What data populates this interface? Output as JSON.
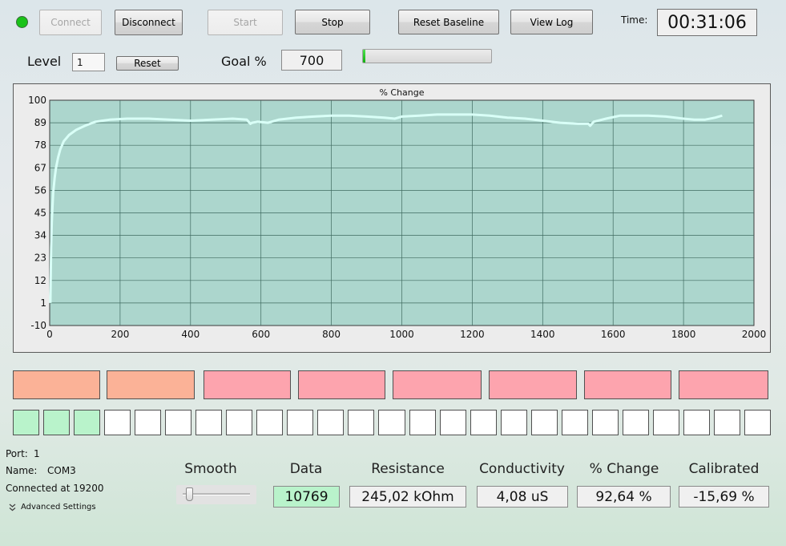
{
  "toolbar": {
    "connect_label": "Connect",
    "disconnect_label": "Disconnect",
    "start_label": "Start",
    "stop_label": "Stop",
    "reset_baseline_label": "Reset Baseline",
    "view_log_label": "View Log",
    "time_label": "Time:",
    "time_value": "00:31:06",
    "status_color": "#19c219"
  },
  "level": {
    "label": "Level",
    "value": "1",
    "reset_label": "Reset"
  },
  "goal": {
    "label": "Goal %",
    "value": "700",
    "progress_fraction": 0.02
  },
  "chart_data": {
    "type": "line",
    "title": "% Change",
    "xlabel": "",
    "ylabel": "",
    "xlim": [
      0,
      2000
    ],
    "ylim": [
      -10,
      100
    ],
    "x_ticks": [
      0,
      200,
      400,
      600,
      800,
      1000,
      1200,
      1400,
      1600,
      1800,
      2000
    ],
    "y_ticks": [
      -10,
      1,
      12,
      23,
      34,
      45,
      56,
      67,
      78,
      89,
      100
    ],
    "grid": true,
    "background_color": "#acd6cd",
    "line_color": "#d9fff7",
    "series": [
      {
        "x": [
          2,
          4,
          6,
          8,
          10,
          14,
          18,
          24,
          30,
          40,
          55,
          75,
          100,
          130,
          170,
          220,
          280,
          340,
          400,
          460,
          520,
          560,
          570,
          575,
          590,
          620,
          650,
          700,
          750,
          800,
          850,
          900,
          950,
          980,
          1000,
          1050,
          1100,
          1150,
          1200,
          1250,
          1300,
          1350,
          1400,
          1450,
          1500,
          1530,
          1535,
          1545,
          1580,
          1620,
          1700,
          1750,
          1800,
          1830,
          1860,
          1890,
          1910
        ],
        "y": [
          1,
          28,
          40,
          48,
          55,
          62,
          67,
          72,
          76,
          80,
          83,
          85.5,
          87.5,
          89.5,
          90.5,
          91,
          91,
          90.5,
          90,
          90.5,
          91,
          90.5,
          88.5,
          89,
          89.5,
          89,
          90.5,
          91.5,
          92,
          92.5,
          92.5,
          92,
          91.5,
          91,
          92,
          92.5,
          93,
          93,
          93,
          92.5,
          91.5,
          91,
          90,
          89,
          88.5,
          88.5,
          87.5,
          89.5,
          91,
          92.5,
          92.5,
          92,
          91,
          90.5,
          90.5,
          91.5,
          92.5
        ]
      }
    ]
  },
  "indicators": {
    "bar_colors": [
      "#fbb297",
      "#fbb297",
      "#fda4ae",
      "#fda4ae",
      "#fda4ae",
      "#fda4ae",
      "#fda4ae",
      "#fda4ae"
    ],
    "cell_active_color": "#b9f3cb",
    "cell_inactive_color": "#ffffff",
    "active_cells": 3,
    "total_cells": 25
  },
  "connection": {
    "port_label": "Port:",
    "port_value": "1",
    "name_label": "Name:",
    "name_value": "COM3",
    "status_text": "Connected at 19200",
    "advanced_label": "Advanced Settings"
  },
  "stats": {
    "smooth_label": "Smooth",
    "smooth_fraction": 0.05,
    "data_label": "Data",
    "data_value": "10769",
    "data_color": "#b9f3cb",
    "resistance_label": "Resistance",
    "resistance_value": "245,02 kOhm",
    "conductivity_label": "Conductivity",
    "conductivity_value": "4,08 uS",
    "change_label": "% Change",
    "change_value": "92,64 %",
    "calibrated_label": "Calibrated",
    "calibrated_value": "-15,69 %"
  }
}
